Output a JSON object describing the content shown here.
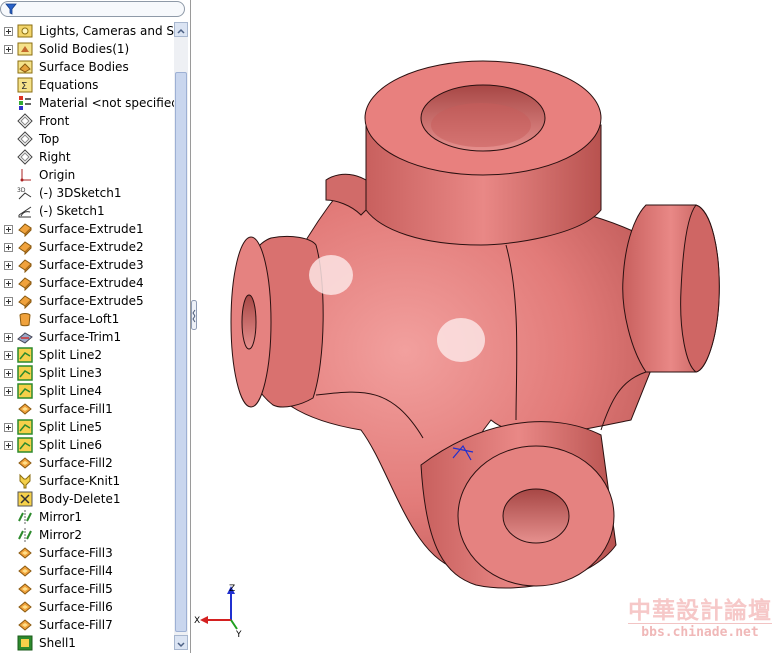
{
  "feature_tree": {
    "items": [
      {
        "label": "Lights, Cameras and S",
        "icon": "lights-icon",
        "expandable": true
      },
      {
        "label": "Solid Bodies(1)",
        "icon": "solid-bodies-folder-icon",
        "expandable": true
      },
      {
        "label": "Surface Bodies",
        "icon": "surface-bodies-folder-icon",
        "expandable": false
      },
      {
        "label": "Equations",
        "icon": "equations-icon",
        "expandable": false
      },
      {
        "label": "Material <not specified",
        "icon": "material-icon",
        "expandable": false
      },
      {
        "label": "Front",
        "icon": "plane-icon",
        "expandable": false
      },
      {
        "label": "Top",
        "icon": "plane-icon",
        "expandable": false
      },
      {
        "label": "Right",
        "icon": "plane-icon",
        "expandable": false
      },
      {
        "label": "Origin",
        "icon": "origin-icon",
        "expandable": false
      },
      {
        "label": "(-) 3DSketch1",
        "icon": "sketch3d-icon",
        "expandable": false
      },
      {
        "label": "(-) Sketch1",
        "icon": "sketch-icon",
        "expandable": false
      },
      {
        "label": "Surface-Extrude1",
        "icon": "surface-extrude-icon",
        "expandable": true
      },
      {
        "label": "Surface-Extrude2",
        "icon": "surface-extrude-icon",
        "expandable": true
      },
      {
        "label": "Surface-Extrude3",
        "icon": "surface-extrude-icon",
        "expandable": true
      },
      {
        "label": "Surface-Extrude4",
        "icon": "surface-extrude-icon",
        "expandable": true
      },
      {
        "label": "Surface-Extrude5",
        "icon": "surface-extrude-icon",
        "expandable": true
      },
      {
        "label": "Surface-Loft1",
        "icon": "surface-loft-icon",
        "expandable": false
      },
      {
        "label": "Surface-Trim1",
        "icon": "surface-trim-icon",
        "expandable": true
      },
      {
        "label": "Split Line2",
        "icon": "split-line-icon",
        "expandable": true
      },
      {
        "label": "Split Line3",
        "icon": "split-line-icon",
        "expandable": true
      },
      {
        "label": "Split Line4",
        "icon": "split-line-icon",
        "expandable": true
      },
      {
        "label": "Surface-Fill1",
        "icon": "surface-fill-icon",
        "expandable": false
      },
      {
        "label": "Split Line5",
        "icon": "split-line-icon",
        "expandable": true
      },
      {
        "label": "Split Line6",
        "icon": "split-line-icon",
        "expandable": true
      },
      {
        "label": "Surface-Fill2",
        "icon": "surface-fill-icon",
        "expandable": false
      },
      {
        "label": "Surface-Knit1",
        "icon": "surface-knit-icon",
        "expandable": false
      },
      {
        "label": "Body-Delete1",
        "icon": "body-delete-icon",
        "expandable": false
      },
      {
        "label": "Mirror1",
        "icon": "mirror-icon",
        "expandable": false
      },
      {
        "label": "Mirror2",
        "icon": "mirror-icon",
        "expandable": false
      },
      {
        "label": "Surface-Fill3",
        "icon": "surface-fill-icon",
        "expandable": false
      },
      {
        "label": "Surface-Fill4",
        "icon": "surface-fill-icon",
        "expandable": false
      },
      {
        "label": "Surface-Fill5",
        "icon": "surface-fill-icon",
        "expandable": false
      },
      {
        "label": "Surface-Fill6",
        "icon": "surface-fill-icon",
        "expandable": false
      },
      {
        "label": "Surface-Fill7",
        "icon": "surface-fill-icon",
        "expandable": false
      },
      {
        "label": "Shell1",
        "icon": "shell-icon",
        "expandable": false
      }
    ]
  },
  "filter": {
    "icon": "filter-icon"
  },
  "triad": {
    "x_label": "X",
    "y_label": "Y",
    "z_label": "Z"
  },
  "watermark": {
    "title": "中華設計論壇",
    "url": "bbs.chinade.net"
  },
  "colors": {
    "model_face": "#e07876",
    "model_edge": "#2a1010",
    "axis_x": "#d42020",
    "axis_y": "#20a020",
    "axis_z": "#2030d0",
    "watermark": "#f2bcbc"
  }
}
